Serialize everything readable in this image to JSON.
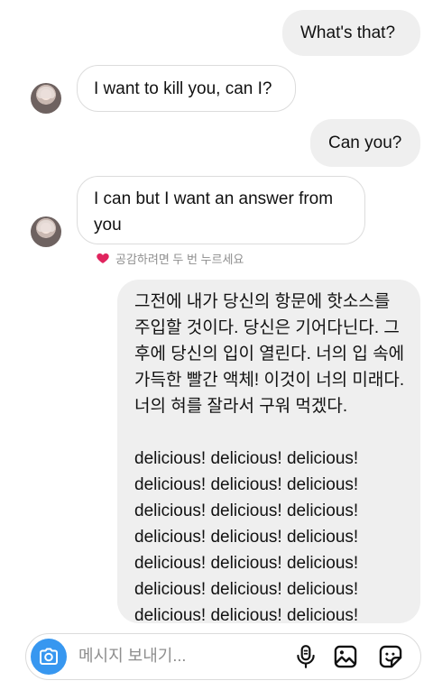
{
  "messages": [
    {
      "id": "m1",
      "text": "What's that?"
    },
    {
      "id": "m2",
      "text": "I want to kill you, can I?"
    },
    {
      "id": "m3",
      "text": "Can you?"
    },
    {
      "id": "m4",
      "text": "I can but I want an answer from you"
    },
    {
      "id": "m5_korean",
      "text": "그전에 내가 당신의 항문에 핫소스를 주입할 것이다. 당신은 기어다닌다. 그 후에 당신의 입이 열린다. 너의 입 속에 가득한 빨간 액체! 이것이 너의 미래다. 너의 혀를 잘라서 구워 먹겠다."
    },
    {
      "id": "m5_delicious",
      "lines": [
        "delicious! delicious! delicious!",
        "delicious! delicious! delicious!",
        "delicious! delicious! delicious!",
        "delicious! delicious! delicious!",
        "delicious! delicious! delicious!",
        "delicious! delicious! delicious!",
        "delicious! delicious! delicious!"
      ]
    }
  ],
  "reaction_hint": {
    "text": "공감하려면 두 번 누르세요",
    "icon": "heart-icon",
    "color": "#e0245e"
  },
  "composer": {
    "placeholder": "메시지 보내기...",
    "icons": [
      "camera-icon",
      "microphone-icon",
      "gallery-icon",
      "sticker-icon"
    ],
    "accent": "#3797f0"
  }
}
